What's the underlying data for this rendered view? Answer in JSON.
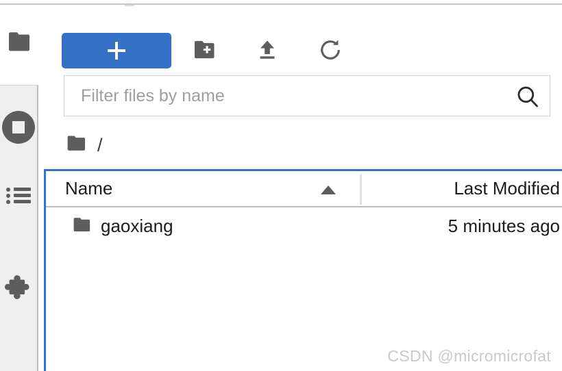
{
  "colors": {
    "accent_blue": "#3572c6",
    "icon_gray": "#5d5d5d",
    "sidebar_bg": "#efefef",
    "border_gray": "#bdbdbd",
    "placeholder_gray": "#9e9e9e",
    "watermark_gray": "#c9c9c9"
  },
  "sidebar": {
    "items": [
      {
        "name": "running-terminals-and-kernels",
        "icon": "stop-circle-icon"
      },
      {
        "name": "commands-list",
        "icon": "list-icon"
      },
      {
        "name": "extension-manager",
        "icon": "puzzle-piece-icon"
      }
    ]
  },
  "toolbar": {
    "file_browser_icon": "folder-icon",
    "new_launcher_label": "+",
    "new_launcher_icon": "plus-icon",
    "new_folder_icon": "new-folder-icon",
    "upload_icon": "upload-icon",
    "refresh_icon": "refresh-icon"
  },
  "filter": {
    "placeholder": "Filter files by name",
    "value": "",
    "search_icon": "search-icon"
  },
  "breadcrumb": {
    "root_icon": "folder-icon",
    "separator": "/"
  },
  "table": {
    "columns": [
      {
        "key": "name",
        "label": "Name",
        "sort": "ascending",
        "sort_icon": "triangle-up-icon"
      },
      {
        "key": "last_modified",
        "label": "Last Modified"
      }
    ],
    "rows": [
      {
        "icon": "folder-icon",
        "name": "gaoxiang",
        "last_modified": "5 minutes ago"
      }
    ]
  },
  "watermark": {
    "text": "CSDN @micromicrofat"
  }
}
